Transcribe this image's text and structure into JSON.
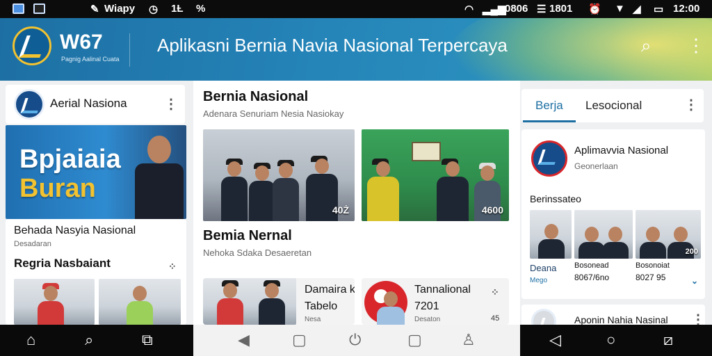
{
  "status_bar": {
    "left_text": "Wiapy",
    "left_icons": [
      "image-icon",
      "gallery-icon",
      "signal-app-icon",
      "clock-icon"
    ],
    "left_extra_1": "1Ƚ",
    "left_extra_2": "%",
    "right_text_1": "0806",
    "right_text_2": "1801",
    "time": "12:00"
  },
  "header": {
    "brand": "W67",
    "brand_sub": "Pagnig Aalinal Cuata",
    "title": "Aplikasni Bernia Navia Nasional Terpercaya",
    "search_icon": "search-icon",
    "menu_icon": "more-vert-icon"
  },
  "left_panel": {
    "card_title": "Aerial Nasiona",
    "banner_line1": "Bpjaiaia",
    "banner_line2": "Buran",
    "article_title": "Behada Nasyia Nasional",
    "article_sub": "Desadaran",
    "section_title": "Regria Nasbaiant"
  },
  "center_panel": {
    "section1_title": "Bernia Nasional",
    "section1_sub": "Adenara Senuriam Nesia Nasiokay",
    "photo1_label": "40Ż",
    "photo2_label": "4600",
    "section2_title": "Bemia Nernal",
    "section2_sub": "Nehoka Sdaka Desaeretan",
    "card3_title": "Damaira k",
    "card3_value": "Tabelo",
    "card3_sub": "Nesa",
    "card4_title": "Tannalional",
    "card4_value": "7201",
    "card4_sub": "Desaton",
    "card4_count": "45"
  },
  "right_panel": {
    "tab_active": "Berja",
    "tab_inactive": "Lesocional",
    "card_title": "Aplimavvia Nasional",
    "card_sub": "Geonerlaan",
    "section_title": "Berinssateo",
    "thumb1_title": "Deana",
    "thumb1_sub": "Mego",
    "thumb2_title": "Bosonead",
    "thumb2_value": "8067/6no",
    "thumb3_title": "Bosonoiat",
    "thumb3_value": "8027 95",
    "thumb3_label": "200",
    "bottom_card_title": "Aponin Nahia Nasinal"
  },
  "nav": {
    "left": [
      "home-icon",
      "search-icon",
      "share-icon"
    ],
    "center": [
      "back-icon",
      "square-icon",
      "power-icon",
      "square-icon",
      "person-icon"
    ],
    "right": [
      "back-icon",
      "circle-icon",
      "edit-icon"
    ]
  },
  "colors": {
    "primary": "#1d6fa3",
    "accent": "#f2c230",
    "status_bar": "#0c0c0c"
  }
}
